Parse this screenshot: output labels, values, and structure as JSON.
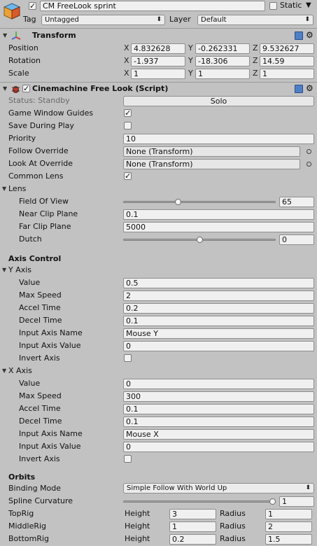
{
  "gameobject": {
    "name": "CM FreeLook sprint",
    "active": true,
    "static_label": "Static",
    "tag_label": "Tag",
    "tag_value": "Untagged",
    "layer_label": "Layer",
    "layer_value": "Default"
  },
  "transform": {
    "title": "Transform",
    "rows": [
      {
        "label": "Position",
        "x": "4.832628",
        "y": "-0.262331",
        "z": "9.532627"
      },
      {
        "label": "Rotation",
        "x": "-1.937",
        "y": "-18.306",
        "z": "14.59"
      },
      {
        "label": "Scale",
        "x": "1",
        "y": "1",
        "z": "1"
      }
    ],
    "axes": [
      "X",
      "Y",
      "Z"
    ]
  },
  "freelook": {
    "title": "Cinemachine Free Look (Script)",
    "enabled": true,
    "status": "Status: Standby",
    "solo_label": "Solo",
    "game_window_guides": {
      "label": "Game Window Guides",
      "checked": true
    },
    "save_during_play": {
      "label": "Save During Play",
      "checked": false
    },
    "priority": {
      "label": "Priority",
      "value": "10"
    },
    "follow_override": {
      "label": "Follow Override",
      "value": "None (Transform)"
    },
    "look_at_override": {
      "label": "Look At Override",
      "value": "None (Transform)"
    },
    "common_lens": {
      "label": "Common Lens",
      "checked": true
    },
    "lens": {
      "label": "Lens",
      "fov": {
        "label": "Field Of View",
        "value": "65",
        "fraction": 0.36
      },
      "near": {
        "label": "Near Clip Plane",
        "value": "0.1"
      },
      "far": {
        "label": "Far Clip Plane",
        "value": "5000"
      },
      "dutch": {
        "label": "Dutch",
        "value": "0",
        "fraction": 0.5
      }
    },
    "axis_control_label": "Axis Control",
    "y_axis": {
      "label": "Y Axis",
      "value": {
        "label": "Value",
        "value": "0.5"
      },
      "max_speed": {
        "label": "Max Speed",
        "value": "2"
      },
      "accel_time": {
        "label": "Accel Time",
        "value": "0.2"
      },
      "decel_time": {
        "label": "Decel Time",
        "value": "0.1"
      },
      "input_axis_name": {
        "label": "Input Axis Name",
        "value": "Mouse Y"
      },
      "input_axis_value": {
        "label": "Input Axis Value",
        "value": "0"
      },
      "invert": {
        "label": "Invert Axis",
        "checked": false
      }
    },
    "x_axis": {
      "label": "X Axis",
      "value": {
        "label": "Value",
        "value": "0"
      },
      "max_speed": {
        "label": "Max Speed",
        "value": "300"
      },
      "accel_time": {
        "label": "Accel Time",
        "value": "0.1"
      },
      "decel_time": {
        "label": "Decel Time",
        "value": "0.1"
      },
      "input_axis_name": {
        "label": "Input Axis Name",
        "value": "Mouse X"
      },
      "input_axis_value": {
        "label": "Input Axis Value",
        "value": "0"
      },
      "invert": {
        "label": "Invert Axis",
        "checked": false
      }
    },
    "orbits": {
      "label": "Orbits",
      "binding_mode": {
        "label": "Binding Mode",
        "value": "Simple Follow With World Up"
      },
      "spline_curvature": {
        "label": "Spline Curvature",
        "value": "1",
        "fraction": 1.0
      },
      "height_label": "Height",
      "radius_label": "Radius",
      "rigs": [
        {
          "label": "TopRig",
          "height": "3",
          "radius": "1"
        },
        {
          "label": "MiddleRig",
          "height": "1",
          "radius": "2"
        },
        {
          "label": "BottomRig",
          "height": "0.2",
          "radius": "1.5"
        }
      ]
    }
  },
  "colors": {
    "background": "#c2c2c2",
    "field": "#f0f0f0",
    "transform_icon_red": "#d33d2d",
    "transform_icon_green": "#55b24a",
    "transform_icon_blue": "#3b6fd4"
  }
}
